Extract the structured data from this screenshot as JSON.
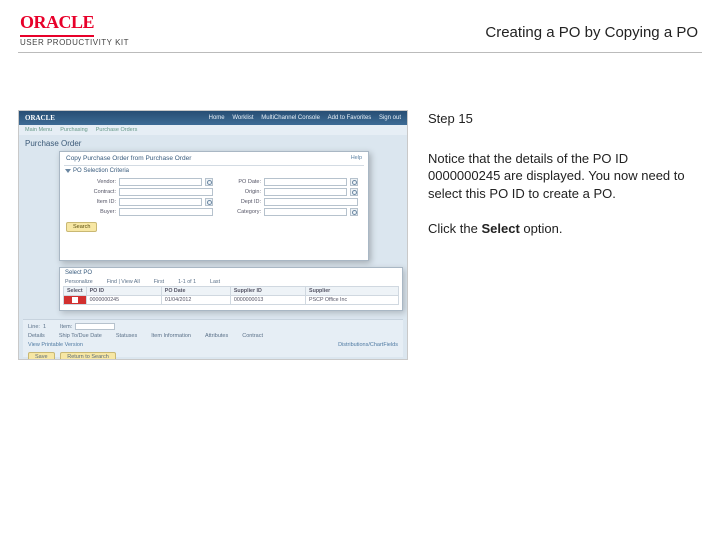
{
  "header": {
    "brand": "ORACLE",
    "subbrand": "USER PRODUCTIVITY KIT",
    "title": "Creating a PO by Copying a PO"
  },
  "instructions": {
    "step": "Step 15",
    "p1": "Notice that the details of the PO ID 0000000245 are displayed. You now need to select this PO ID to create a PO.",
    "p2a": "Click the ",
    "p2b": "Select",
    "p2c": " option."
  },
  "screenshot": {
    "brand": "ORACLE",
    "nav": {
      "a": "Home",
      "b": "Worklist",
      "c": "MultiChannel Console",
      "d": "Add to Favorites",
      "e": "Sign out"
    },
    "crumbs": {
      "a": "Main Menu",
      "b": "Purchasing",
      "c": "Purchase Orders"
    },
    "page_title": "Purchase Order",
    "modal": {
      "title": "Copy Purchase Order from Purchase Order",
      "help": "Help",
      "section": "PO Selection Criteria",
      "fields": {
        "vendor": "Vendor:",
        "po_date": "PO Date:",
        "contract": "Contract:",
        "origin": "Origin:",
        "item_id": "Item ID:",
        "dept_id": "Dept ID:",
        "buyer": "Buyer:",
        "category": "Category:"
      },
      "search": "Search"
    },
    "results": {
      "title": "Select PO",
      "pager": {
        "a": "Personalize",
        "b": "Find | View All",
        "c": "First",
        "d": "1-1 of 1",
        "e": "Last"
      },
      "cols": {
        "sel": "Select",
        "poid": "PO ID",
        "date": "PO Date",
        "supid": "Supplier ID",
        "sup": "Supplier"
      },
      "row": {
        "poid": "0000000245",
        "date": "01/04/2012",
        "supid": "0000000013",
        "sup": "PSCP Office Inc"
      }
    },
    "lower": {
      "linesA": {
        "a": "Line:",
        "b": "1",
        "c": "Item:"
      },
      "tabrow": {
        "a": "Details",
        "b": "Ship To/Due Date",
        "c": "Statuses",
        "d": "Item Information",
        "e": "Attributes",
        "f": "Contract"
      },
      "adds": "View Printable Version",
      "center": "Distributions/ChartFields",
      "btn_save": "Save",
      "btn_return": "Return to Search"
    }
  }
}
